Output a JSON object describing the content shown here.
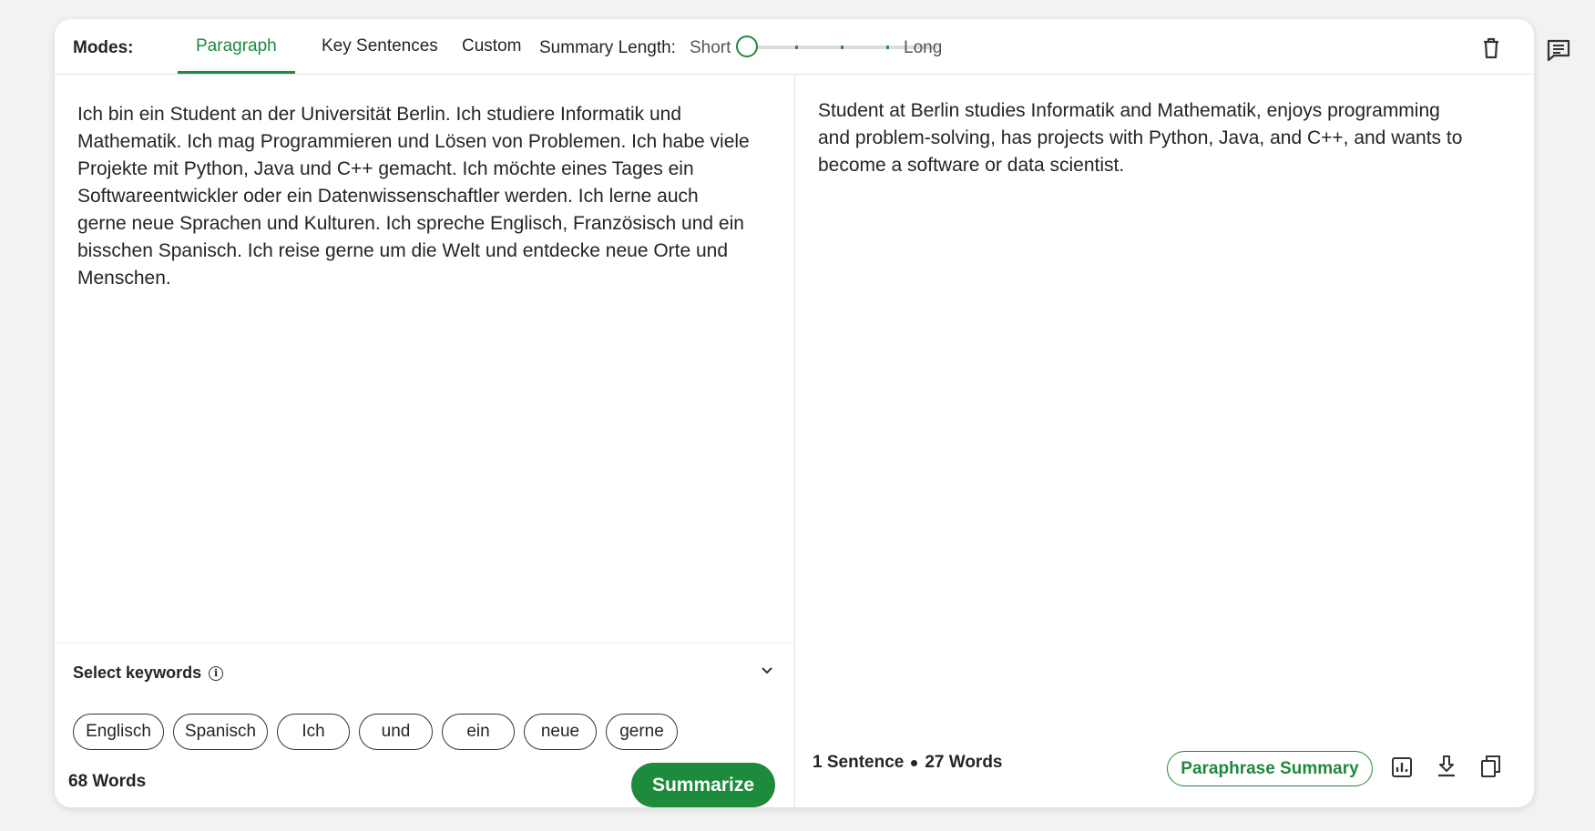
{
  "toolbar": {
    "modes_label": "Modes:",
    "tabs": [
      {
        "label": "Paragraph",
        "active": true
      },
      {
        "label": "Key Sentences",
        "active": false
      },
      {
        "label": "Custom",
        "active": false
      }
    ],
    "summary_length_label": "Summary Length:",
    "short_label": "Short",
    "long_label": "Long",
    "summary_length_level": 0
  },
  "input": {
    "text": "Ich bin ein Student an der Universität Berlin. Ich studiere Informatik und Mathematik. Ich mag Programmieren und Lösen von Problemen. Ich habe viele Projekte mit Python, Java und C++ gemacht. Ich möchte eines Tages ein Softwareentwickler oder ein Datenwissenschaftler werden. Ich lerne auch gerne neue Sprachen und Kulturen. Ich spreche Englisch, Französisch und ein bisschen Spanisch. Ich reise gerne um die Welt und entdecke neue Orte und Menschen.",
    "keywords_label": "Select keywords",
    "keywords": [
      "Englisch",
      "Spanisch",
      "Ich",
      "und",
      "ein",
      "neue",
      "gerne"
    ],
    "word_count": "68 Words",
    "summarize_label": "Summarize"
  },
  "output": {
    "text": "Student at Berlin studies Informatik and Mathematik, enjoys programming and problem-solving, has projects with Python, Java, and C++, and wants to become a software or data scientist.",
    "sentence_count": "1 Sentence",
    "word_count": "27 Words",
    "paraphrase_label": "Paraphrase Summary"
  },
  "colors": {
    "accent": "#1e8a3c",
    "text": "#252525",
    "background": "#f2f2f2"
  },
  "icons": [
    "trash-icon",
    "feedback-icon",
    "info-icon",
    "chevron-down-icon",
    "statistics-icon",
    "download-icon",
    "copy-icon"
  ]
}
